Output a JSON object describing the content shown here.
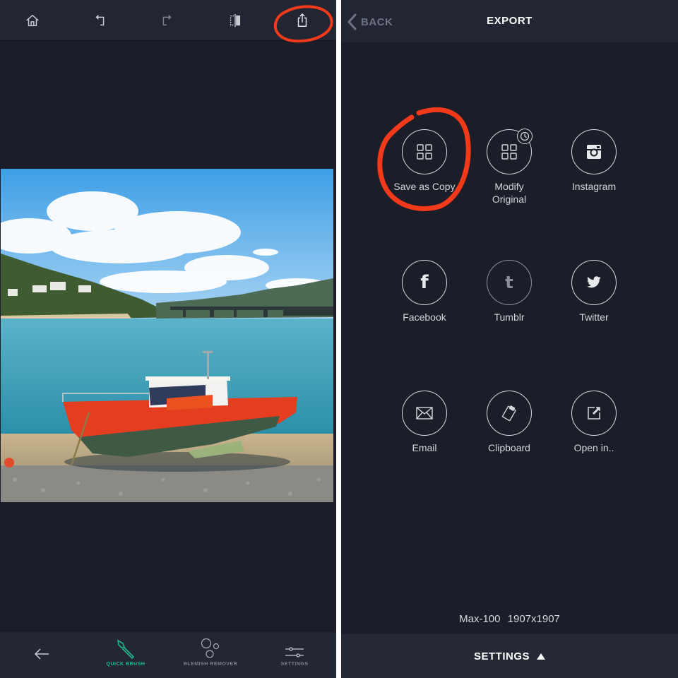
{
  "editor": {
    "toolbar": {
      "home": "home-icon",
      "undo": "undo-icon",
      "redo": "redo-icon",
      "compare": "compare-icon",
      "share": "share-icon"
    },
    "photo_description": "Red fishing boat on a pebble beach with estuary, bridge and hills",
    "bottom_nav": {
      "back": "back-arrow-icon",
      "items": [
        {
          "label": "QUICK BRUSH",
          "icon": "brush-icon",
          "active": true
        },
        {
          "label": "BLEMISH REMOVER",
          "icon": "bubbles-icon",
          "active": false
        },
        {
          "label": "SETTINGS",
          "icon": "sliders-icon",
          "active": false
        }
      ]
    }
  },
  "export": {
    "back_label": "BACK",
    "title": "EXPORT",
    "options": [
      {
        "label": "Save as Copy",
        "icon": "grid-icon"
      },
      {
        "label": "Modify Original",
        "icon": "grid-clock-icon"
      },
      {
        "label": "Instagram",
        "icon": "instagram-icon"
      },
      {
        "label": "Facebook",
        "icon": "facebook-icon"
      },
      {
        "label": "Tumblr",
        "icon": "tumblr-icon"
      },
      {
        "label": "Twitter",
        "icon": "twitter-icon"
      },
      {
        "label": "Email",
        "icon": "envelope-icon"
      },
      {
        "label": "Clipboard",
        "icon": "clipboard-icon"
      },
      {
        "label": "Open in..",
        "icon": "open-in-icon"
      }
    ],
    "quality": "Max-100",
    "dimensions": "1907x1907",
    "settings_label": "SETTINGS"
  },
  "colors": {
    "background": "#1b1e28",
    "toolbar": "#222632",
    "accent_green": "#1fb88a",
    "annotation_red": "#f23a1a"
  }
}
